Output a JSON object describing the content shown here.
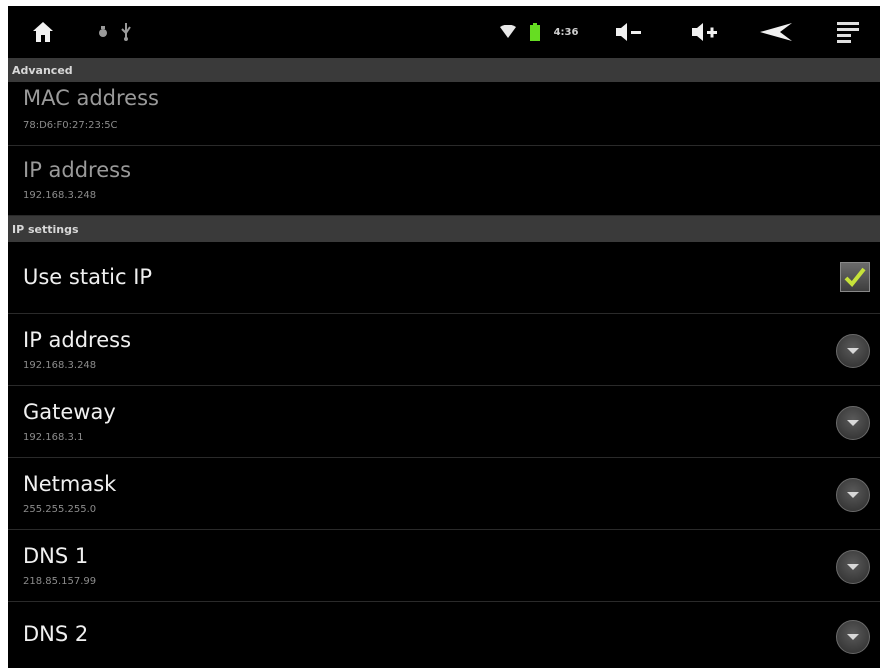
{
  "statusbar": {
    "battery_text": "4:36",
    "icons": [
      "home-icon",
      "usb-debug-icon",
      "usb-icon",
      "wifi-icon",
      "battery-icon",
      "volume-down-icon",
      "volume-up-icon",
      "back-icon",
      "menu-icon"
    ]
  },
  "sections": {
    "advanced": "Advanced",
    "ip_settings": "IP settings"
  },
  "advanced_items": [
    {
      "title": "MAC address",
      "value": "78:D6:F0:27:23:5C"
    },
    {
      "title": "IP address",
      "value": "192.168.3.248"
    }
  ],
  "ip_settings_items": {
    "use_static_ip": {
      "title": "Use static IP",
      "checked": true
    },
    "ip_address": {
      "title": "IP address",
      "value": "192.168.3.248"
    },
    "gateway": {
      "title": "Gateway",
      "value": "192.168.3.1"
    },
    "netmask": {
      "title": "Netmask",
      "value": "255.255.255.0"
    },
    "dns1": {
      "title": "DNS 1",
      "value": "218.85.157.99"
    },
    "dns2": {
      "title": "DNS 2",
      "value": ""
    }
  },
  "colors": {
    "check": "#c6e23a",
    "wifi": "#e8e8e8",
    "battery": "#66dd22"
  }
}
